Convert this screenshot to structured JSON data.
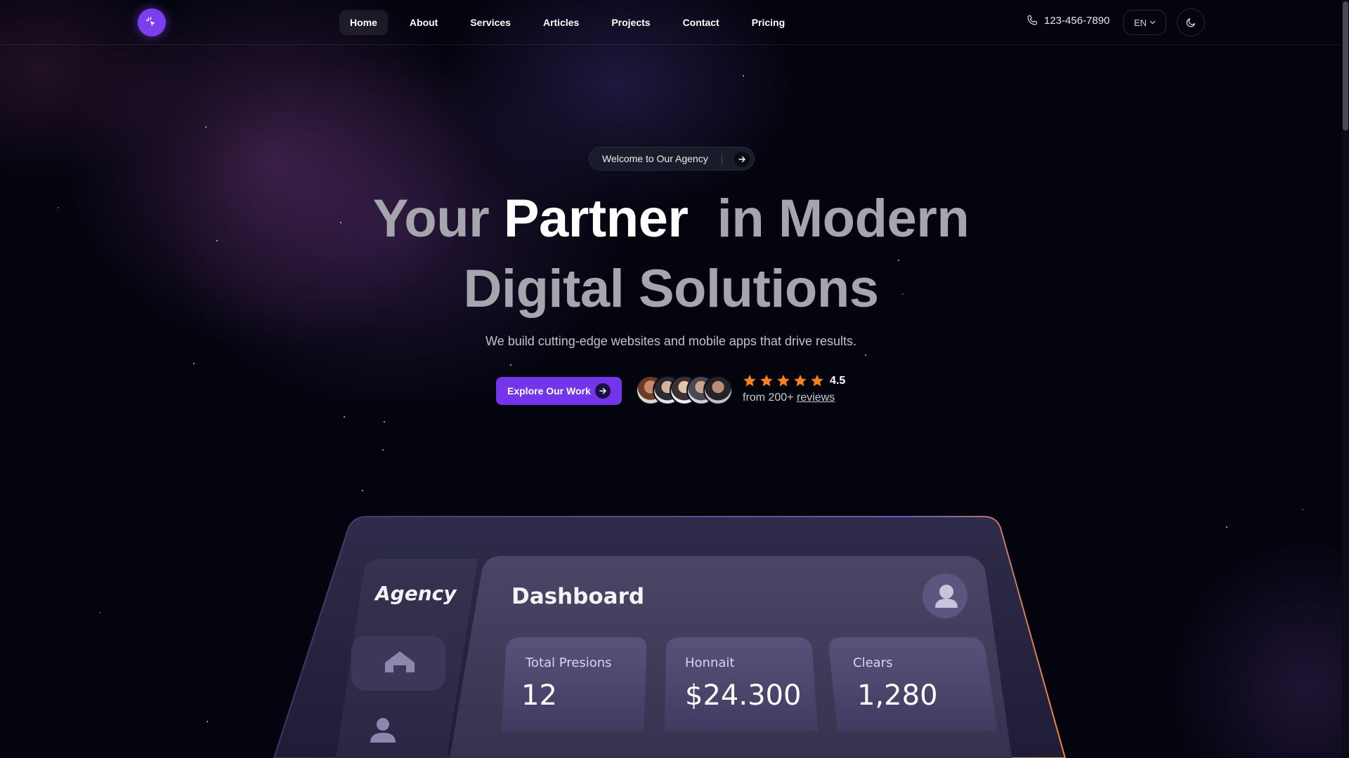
{
  "header": {
    "logo_icon": "sparkle-cursor-icon",
    "nav": [
      {
        "label": "Home",
        "active": true
      },
      {
        "label": "About",
        "active": false
      },
      {
        "label": "Services",
        "active": false
      },
      {
        "label": "Articles",
        "active": false
      },
      {
        "label": "Projects",
        "active": false
      },
      {
        "label": "Contact",
        "active": false
      },
      {
        "label": "Pricing",
        "active": false
      }
    ],
    "phone": "123-456-7890",
    "language": "EN",
    "theme_icon": "moon-icon"
  },
  "hero": {
    "badge": "Welcome to Our Agency",
    "title_line1_a": "Your ",
    "title_line1_b": "Partner",
    "title_line1_c": "  in Modern",
    "title_line2": "Digital Solutions",
    "subtitle": "We build cutting-edge websites and mobile apps that drive results.",
    "cta_label": "Explore Our Work",
    "rating_value": "4.5",
    "rating_stars": 5,
    "rating_prefix": "from 200+ ",
    "rating_link": "reviews"
  },
  "dashboard": {
    "brand": "Agency",
    "title": "Dashboard",
    "cards": [
      {
        "label": "Total Presions",
        "value": "12"
      },
      {
        "label": "Honnait",
        "value": "$24.300"
      },
      {
        "label": "Clears",
        "value": "1,280"
      }
    ]
  },
  "colors": {
    "accent": "#7434ea",
    "background": "#04040f",
    "star": "#f5821f"
  }
}
